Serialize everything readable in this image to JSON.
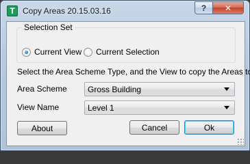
{
  "window": {
    "title": "Copy Areas 20.15.03.16",
    "icon": "revit-app-icon",
    "icon_glyph": "T",
    "help_glyph": "?",
    "close_glyph": "✕"
  },
  "selection_set": {
    "label": "Selection Set",
    "options": [
      {
        "label": "Current View",
        "checked": true
      },
      {
        "label": "Current Selection",
        "checked": false
      }
    ]
  },
  "instructions": "Select the Area Scheme Type, and the View to copy the Areas to.",
  "area_scheme": {
    "label": "Area Scheme",
    "value": "Gross Building"
  },
  "view_name": {
    "label": "View Name",
    "value": "Level 1"
  },
  "buttons": {
    "about": "About",
    "cancel": "Cancel",
    "ok": "Ok"
  },
  "colors": {
    "close_button": "#c4442b",
    "app_icon": "#1e9c5a",
    "default_button_border": "#3c7fb1"
  }
}
